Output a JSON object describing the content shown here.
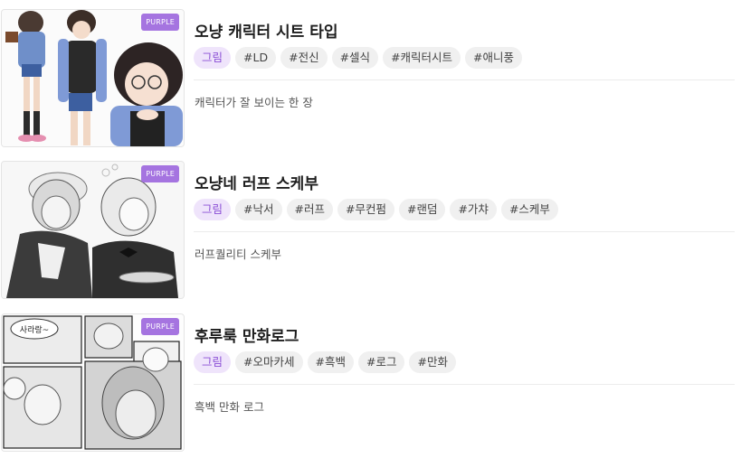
{
  "posts": [
    {
      "badge": "PURPLE",
      "title": "오냥 캐릭터 시트 타입",
      "category": "그림",
      "tags": [
        "#LD",
        "#전신",
        "#셀식",
        "#캐릭터시트",
        "#애니풍"
      ],
      "description": "캐릭터가 잘 보이는 한 장"
    },
    {
      "badge": "PURPLE",
      "title": "오냥네 러프 스케부",
      "category": "그림",
      "tags": [
        "#낙서",
        "#러프",
        "#무컨펌",
        "#랜덤",
        "#가챠",
        "#스케부"
      ],
      "description": "러프퀄리티 스케부"
    },
    {
      "badge": "PURPLE",
      "title": "후루룩 만화로그",
      "category": "그림",
      "tags": [
        "#오마카세",
        "#흑백",
        "#로그",
        "#만화"
      ],
      "description": "흑백 만화 로그"
    }
  ],
  "thumb_texts": {
    "bubble_left": "사라랑~"
  }
}
